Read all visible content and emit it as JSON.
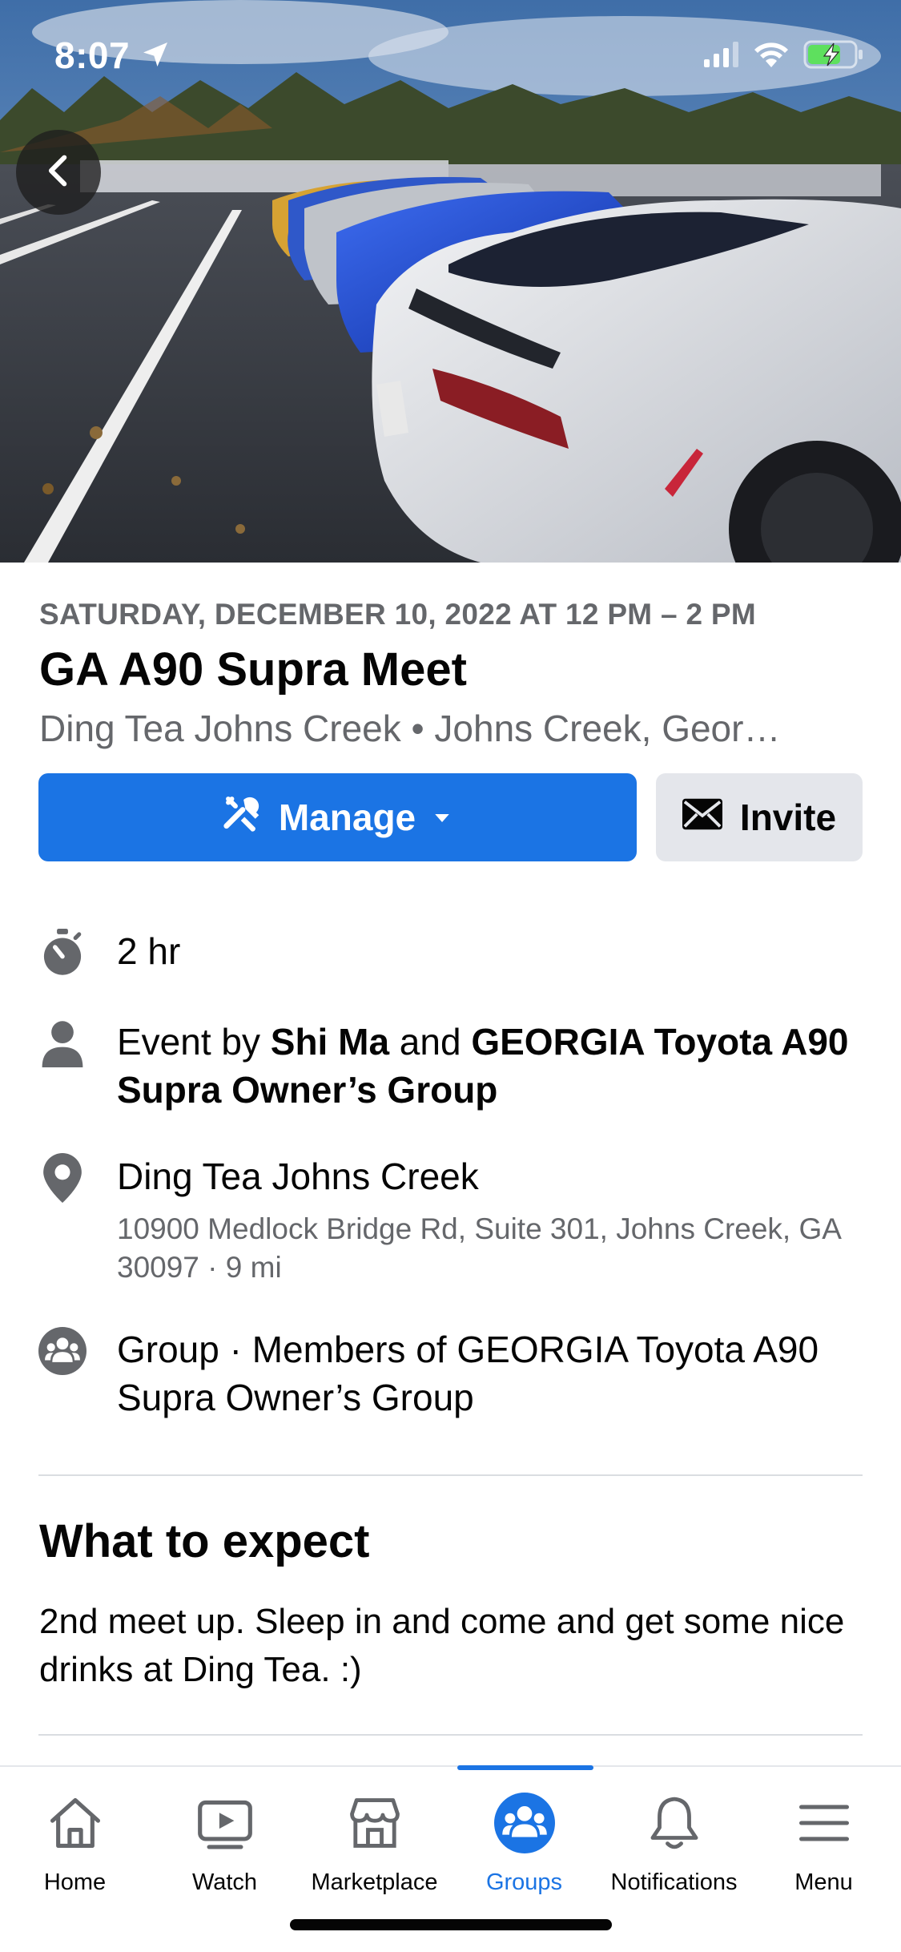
{
  "status_bar": {
    "time": "8:07",
    "location_icon": "location-arrow-icon",
    "signal_icon": "cellular-signal-icon",
    "wifi_icon": "wifi-icon",
    "battery_icon": "battery-charging-icon"
  },
  "hero": {
    "back_icon": "chevron-left-icon"
  },
  "event": {
    "date": "SATURDAY, DECEMBER 10, 2022 AT 12 PM – 2 PM",
    "title": "GA A90 Supra Meet",
    "location_line": "Ding Tea Johns Creek • Johns Creek, Geor…"
  },
  "actions": {
    "manage_label": "Manage",
    "manage_icon": "tools-icon",
    "dropdown_icon": "caret-down-icon",
    "invite_label": "Invite",
    "invite_icon": "envelope-icon"
  },
  "details": {
    "duration": {
      "icon": "stopwatch-icon",
      "text": "2 hr"
    },
    "host": {
      "icon": "person-icon",
      "prefix": "Event by ",
      "host1": "Shi Ma",
      "conj": " and ",
      "host2": "GEORGIA Toyota A90 Supra Owner’s Group"
    },
    "place": {
      "icon": "map-pin-icon",
      "name": "Ding Tea Johns Creek",
      "address": "10900 Medlock Bridge Rd, Suite 301, Johns Creek, GA 30097 · 9 mi"
    },
    "privacy": {
      "icon": "group-icon",
      "text": "Group · Members of GEORGIA Toyota A90 Supra Owner’s Group"
    }
  },
  "expect": {
    "heading": "What to expect",
    "body": "2nd meet up.  Sleep in and come and get some nice drinks at Ding Tea. :)"
  },
  "tabs": [
    {
      "label": "Home",
      "icon": "home-icon",
      "active": false
    },
    {
      "label": "Watch",
      "icon": "watch-video-icon",
      "active": false
    },
    {
      "label": "Marketplace",
      "icon": "marketplace-store-icon",
      "active": false
    },
    {
      "label": "Groups",
      "icon": "groups-icon",
      "active": true
    },
    {
      "label": "Notifications",
      "icon": "bell-icon",
      "active": false
    },
    {
      "label": "Menu",
      "icon": "hamburger-menu-icon",
      "active": false
    }
  ],
  "colors": {
    "accent": "#1b74e4",
    "secondary_text": "#65676b",
    "invite_bg": "#e4e6eb"
  }
}
